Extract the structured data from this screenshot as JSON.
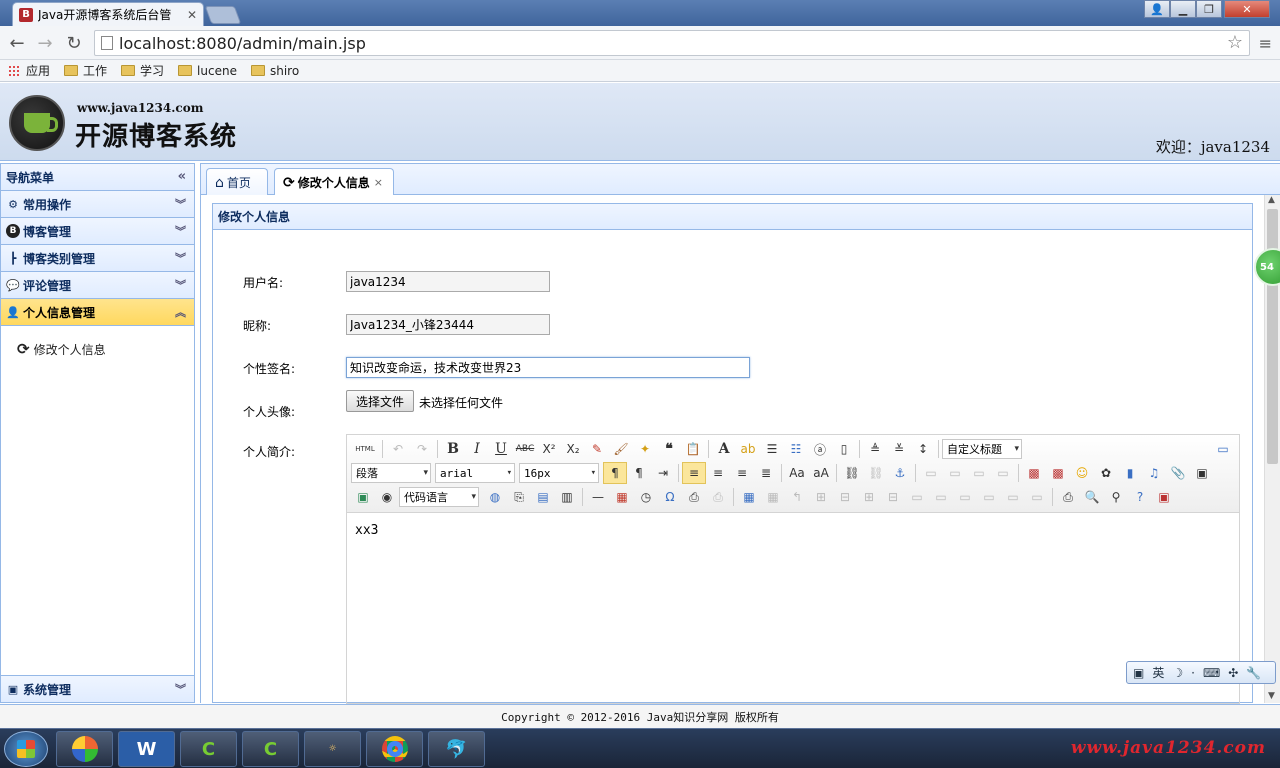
{
  "browser": {
    "tab_title": "Java开源博客系统后台管",
    "tab_favicon": "B",
    "url": "localhost:8080/admin/main.jsp",
    "bookmarks": [
      "应用",
      "工作",
      "学习",
      "lucene",
      "shiro"
    ]
  },
  "header": {
    "site_url": "www.java1234.com",
    "site_title": "开源博客系统",
    "welcome": "欢迎：java1234"
  },
  "nav": {
    "title": "导航菜单",
    "items": [
      {
        "label": "常用操作"
      },
      {
        "label": "博客管理"
      },
      {
        "label": "博客类别管理"
      },
      {
        "label": "评论管理"
      },
      {
        "label": "个人信息管理"
      }
    ],
    "active_sub": "修改个人信息",
    "bottom": "系统管理"
  },
  "tabs": [
    {
      "label": "首页"
    },
    {
      "label": "修改个人信息"
    }
  ],
  "panel": {
    "title": "修改个人信息",
    "username_label": "用户名:",
    "username_value": "java1234",
    "nickname_label": "昵称:",
    "nickname_value": "Java1234_小锋23444",
    "sign_label": "个性签名:",
    "sign_value": "知识改变命运，技术改变世界23",
    "avatar_label": "个人头像:",
    "file_button": "选择文件",
    "file_status": "未选择任何文件",
    "profile_label": "个人简介:"
  },
  "editor": {
    "html_label": "HTML",
    "custom_title": "自定义标题",
    "paragraph": "段落",
    "font": "arial",
    "size": "16px",
    "code_lang": "代码语言",
    "content": "xx3"
  },
  "badge": "54",
  "ime": {
    "mode": "英"
  },
  "footer": "Copyright © 2012-2016 Java知识分享网 版权所有",
  "taskbar_watermark": "www.java1234.com"
}
